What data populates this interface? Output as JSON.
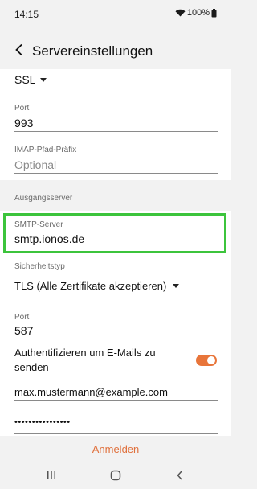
{
  "status_bar": {
    "time": "14:15",
    "battery": "100%",
    "wifi_icon": "wifi-icon",
    "battery_icon": "battery-icon"
  },
  "header": {
    "title": "Servereinstellungen",
    "back_icon": "chevron-left-icon"
  },
  "incoming": {
    "security_value": "SSL",
    "port_label": "Port",
    "port_value": "993",
    "imap_prefix_label": "IMAP-Pfad-Präfix",
    "imap_prefix_placeholder": "Optional"
  },
  "outgoing": {
    "section_title": "Ausgangsserver",
    "smtp_label": "SMTP-Server",
    "smtp_value": "smtp.ionos.de",
    "security_label": "Sicherheitstyp",
    "security_value": "TLS (Alle Zertifikate akzeptieren)",
    "port_label": "Port",
    "port_value": "587",
    "auth_label": "Authentifizieren um E-Mails zu senden",
    "auth_enabled": true,
    "username_value": "max.mustermann@example.com",
    "password_value": "••••••••••••••••"
  },
  "actions": {
    "login_label": "Anmelden"
  },
  "colors": {
    "accent": "#e8753a",
    "highlight": "#3cc43c",
    "background": "#f2f2f2"
  },
  "nav": {
    "recents_icon": "recents-icon",
    "home_icon": "home-icon",
    "back_icon": "back-icon"
  }
}
